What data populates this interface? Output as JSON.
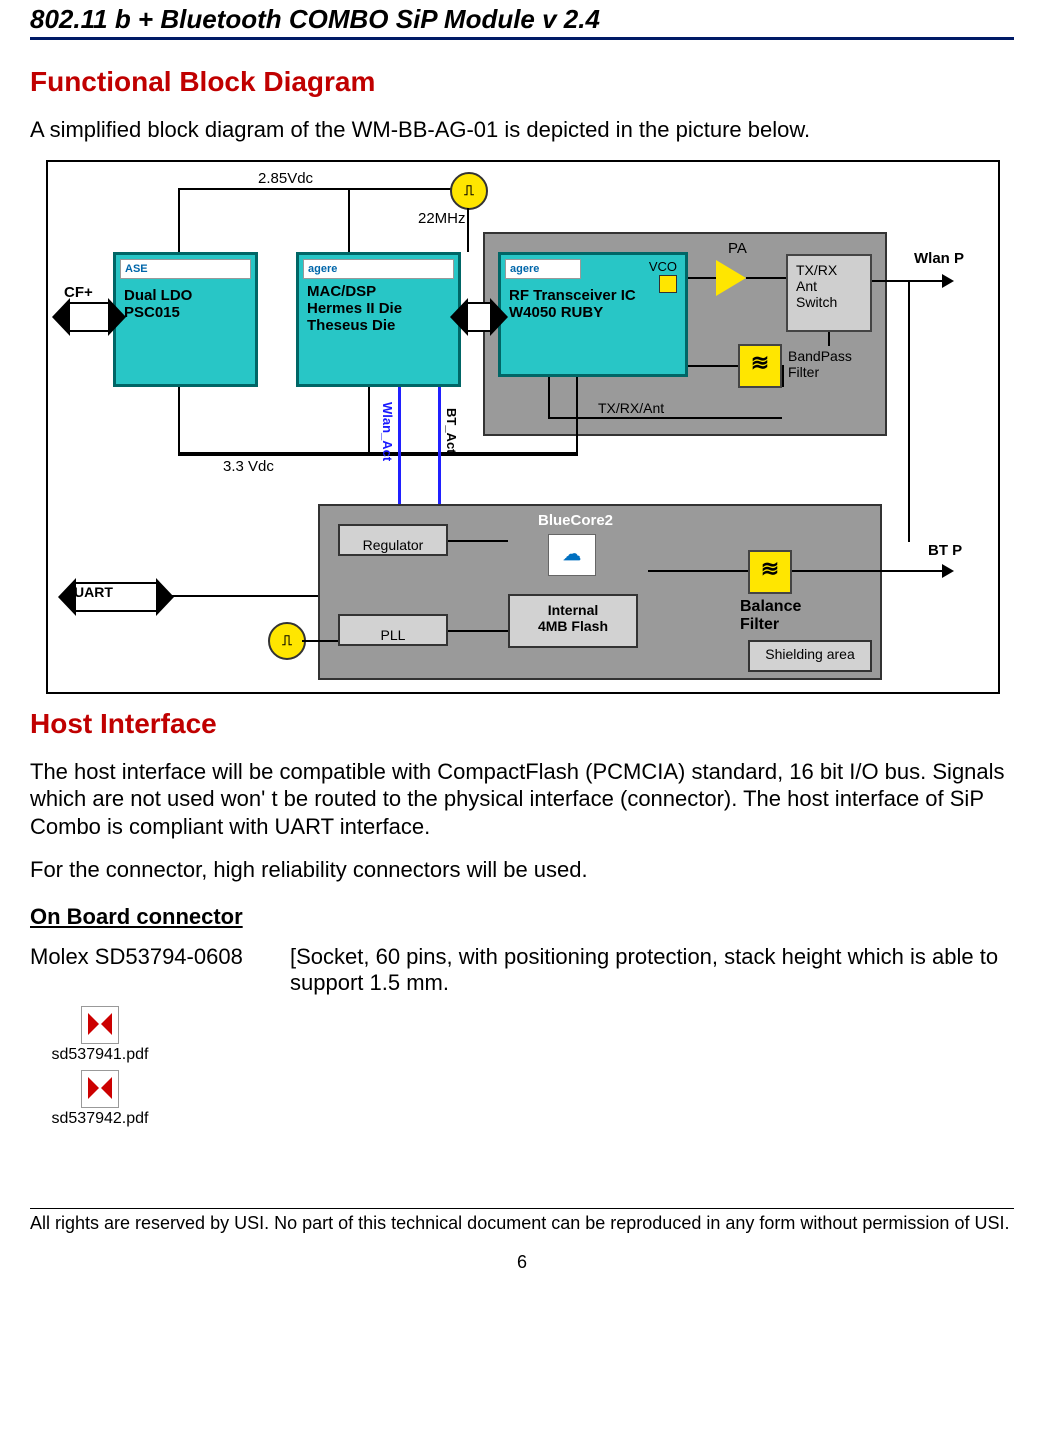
{
  "header": {
    "title": "802.11 b + Bluetooth COMBO SiP Module v 2.4"
  },
  "section1": {
    "title": "Functional Block Diagram",
    "intro": "A simplified block diagram of the WM-BB-AG-01 is depicted in the picture below."
  },
  "diagram": {
    "v285": "2.85Vdc",
    "v33": "3.3 Vdc",
    "mhz22": "22MHz",
    "cfplus": "CF+",
    "uart": "UART",
    "wlan_p": "Wlan  P",
    "bt_p": "BT  P",
    "ldo_logo": "ASE",
    "ldo_l1": "Dual LDO",
    "ldo_l2": "PSC015",
    "mac_logo": "agere",
    "mac_l1": "MAC/DSP",
    "mac_l2": "Hermes II Die",
    "mac_l3": "Theseus Die",
    "rf_logo": "agere",
    "rf_vco": "VCO",
    "rf_l1": "RF Transceiver IC",
    "rf_l2": "W4050 RUBY",
    "pa": "PA",
    "sw_l1": "TX/RX",
    "sw_l2": "Ant",
    "sw_l3": "Switch",
    "bpf_l1": "BandPass",
    "bpf_l2": "Filter",
    "txrxant": "TX/RX/Ant",
    "wlan_act": "Wlan_Act",
    "bt_act": "BT_Act",
    "reg": "Regulator",
    "pll": "PLL",
    "bluecore": "BlueCore2",
    "flash_l1": "Internal",
    "flash_l2": "4MB Flash",
    "bal_l1": "Balance",
    "bal_l2": "Filter",
    "shield_lbl": "Shielding area",
    "osc": "⎍"
  },
  "section2": {
    "title": "Host Interface",
    "para1": "The host interface will be compatible with CompactFlash (PCMCIA) standard, 16 bit I/O bus. Signals which are not used won' t be routed to the physical interface (connector). The host interface of SiP Combo is compliant with UART interface.",
    "para2": "For the connector, high reliability connectors will be used.",
    "sub": "On Board connector",
    "conn_name": "Molex  SD53794-0608",
    "conn_desc": "[Socket, 60 pins, with positioning protection, stack height which is able to support 1.5 mm."
  },
  "attachments": {
    "pdf1": "sd537941.pdf",
    "pdf2": "sd537942.pdf"
  },
  "footer": {
    "text": "All rights are reserved by USI. No part of this technical document can be reproduced in any form without permission of USI.",
    "page": "6"
  }
}
